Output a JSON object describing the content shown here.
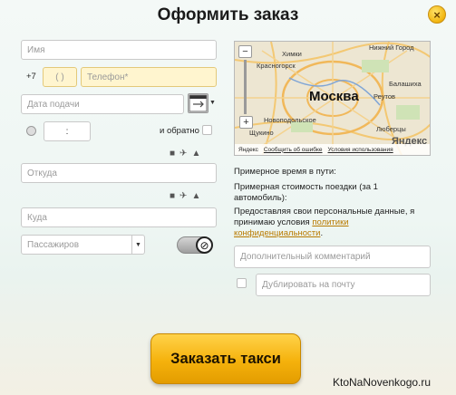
{
  "title": "Оформить заказ",
  "close_symbol": "×",
  "form": {
    "name_placeholder": "Имя",
    "phone_prefix": "+7",
    "phone_code_placeholder": "(     )",
    "phone_placeholder": "Телефон*",
    "date_placeholder": "Дата подачи",
    "time_separator": ":",
    "return_label": "и обратно",
    "from_placeholder": "Откуда",
    "to_placeholder": "Куда",
    "passengers_placeholder": "Пассажиров",
    "comment_placeholder": "Дополнительный комментарий",
    "duplicate_placeholder": "Дублировать на почту"
  },
  "map": {
    "city": "Москва",
    "labels": [
      "Химки",
      "Нижний Город",
      "Красногорск",
      "Балашиха",
      "Реутов",
      "Новоподольское",
      "Люберцы",
      "Щукино"
    ],
    "zoom_in": "+",
    "zoom_out": "−",
    "brand": "Яндекс",
    "footer": [
      "Яндекс",
      "Сообщить об ошибке",
      "Условия использования"
    ]
  },
  "info": {
    "time_label": "Примерное время в пути:",
    "cost_label": "Примерная стоимость поездки (за 1 автомобиль):",
    "consent_text": "Предоставляя свои персональные данные, я принимаю условия",
    "consent_link": "политики конфиденциальности",
    "consent_end": "."
  },
  "order_button": "Заказать такси",
  "watermark": "KtoNaNovenkogo.ru",
  "icons": [
    "close-icon",
    "calendar-icon",
    "dropdown-icon",
    "clock-icon",
    "train-icon",
    "plane-icon",
    "car-icon",
    "no-smoking-icon"
  ],
  "colors": {
    "accent": "#f5b20c",
    "field_highlight": "#fff5cf",
    "link": "#b87a00"
  }
}
